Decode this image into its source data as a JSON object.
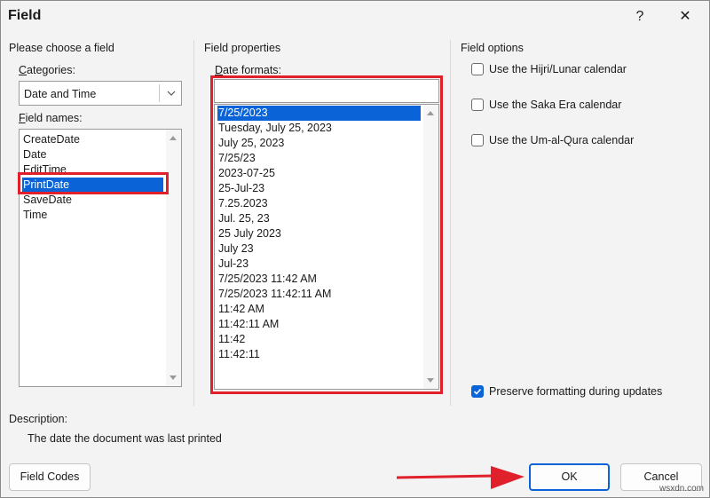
{
  "window": {
    "title": "Field",
    "help_glyph": "?",
    "close_glyph": "✕"
  },
  "left": {
    "header": "Please choose a field",
    "categories_label": "Categories:",
    "categories_value": "Date and Time",
    "field_names_label": "Field names:",
    "field_names": [
      "CreateDate",
      "Date",
      "EditTime",
      "PrintDate",
      "SaveDate",
      "Time"
    ],
    "selected_field": "PrintDate"
  },
  "middle": {
    "header": "Field properties",
    "date_formats_label": "Date formats:",
    "date_format_input": "",
    "date_formats": [
      "7/25/2023",
      "Tuesday, July 25, 2023",
      "July 25, 2023",
      "7/25/23",
      "2023-07-25",
      "25-Jul-23",
      "7.25.2023",
      "Jul. 25, 23",
      "25 July 2023",
      "July 23",
      "Jul-23",
      "7/25/2023 11:42 AM",
      "7/25/2023 11:42:11 AM",
      "11:42 AM",
      "11:42:11 AM",
      "11:42",
      "11:42:11"
    ],
    "selected_format": "7/25/2023"
  },
  "right": {
    "header": "Field options",
    "options": [
      {
        "label": "Use the Hijri/Lunar calendar",
        "checked": false
      },
      {
        "label": "Use the Saka Era calendar",
        "checked": false
      },
      {
        "label": "Use the Um-al-Qura calendar",
        "checked": false
      }
    ],
    "preserve_label": "Preserve formatting during updates",
    "preserve_checked": true
  },
  "description": {
    "label": "Description:",
    "text": "The date the document was last printed"
  },
  "buttons": {
    "field_codes": "Field Codes",
    "ok": "OK",
    "cancel": "Cancel"
  },
  "watermark": "wsxdn.com",
  "colors": {
    "accent": "#0a64d8",
    "highlight": "#e0202a"
  }
}
